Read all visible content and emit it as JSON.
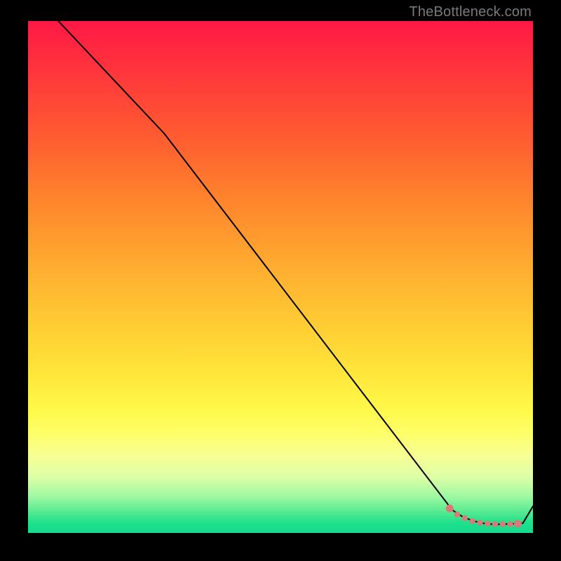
{
  "attribution": "TheBottleneck.com",
  "chart_data": {
    "type": "line",
    "title": "",
    "xlabel": "",
    "ylabel": "",
    "xlim": [
      0,
      100
    ],
    "ylim": [
      0,
      100
    ],
    "grid": false,
    "series": [
      {
        "name": "curve",
        "x": [
          6,
          27,
          84,
          86,
          88,
          90,
          92,
          94,
          98,
          100
        ],
        "values": [
          100,
          78,
          4.5,
          3.2,
          2.4,
          1.9,
          1.7,
          1.7,
          1.9,
          5.2
        ]
      }
    ],
    "highlight_points": {
      "name": "dotted-flat-region",
      "color": "#d97a78",
      "x": [
        83.5,
        85,
        86.5,
        88,
        89.5,
        91,
        92.5,
        94,
        95.5,
        97
      ],
      "values": [
        4.8,
        3.6,
        2.9,
        2.3,
        2.0,
        1.8,
        1.7,
        1.7,
        1.7,
        1.8
      ]
    }
  }
}
